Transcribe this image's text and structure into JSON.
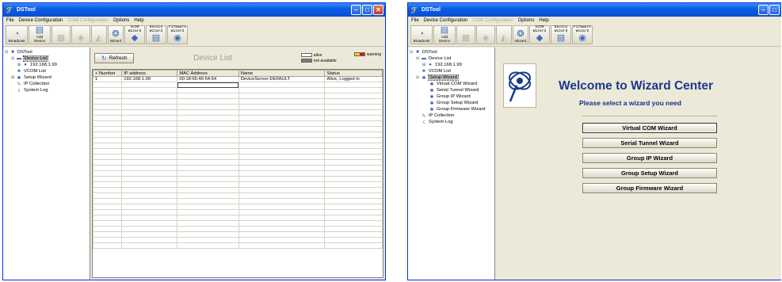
{
  "app": {
    "title": "DSTool"
  },
  "menu": {
    "file": "File",
    "device_config": "Device Configuration",
    "com_config": "COM Configuration",
    "options": "Options",
    "help": "Help"
  },
  "toolbar": {
    "broadcast": "Broadcast",
    "add_device_1": "Add",
    "add_device_2": "Device",
    "wizard": "Wizard",
    "vcom_wizard_1": "VCOM",
    "vcom_wizard_2": "Wizard",
    "device_wizard_1": "Device",
    "device_wizard_2": "Wizard",
    "firmware_wizard_1": "Firmware",
    "firmware_wizard_2": "Wizard"
  },
  "tree": {
    "root": "DSTool",
    "device_list": "Device List",
    "ip_node": "192.168.1.99",
    "vcom_list": "VCOM List",
    "setup_wizard": "Setup Wizard",
    "ip_collection": "IP Collection",
    "system_log": "System Log",
    "wizards": [
      "Virtual COM Wizard",
      "Serial Tunnel Wizard",
      "Group IP Wizard",
      "Group Setup Wizard",
      "Group Firmware Wizard"
    ]
  },
  "device_list": {
    "refresh": "Refresh",
    "title": "Device List",
    "legend": {
      "alive": "alive",
      "not_available": "not available",
      "warning": "warning"
    },
    "columns": [
      "+ Number",
      "IP address",
      "MAC Address",
      "Name",
      "Status"
    ],
    "rows": [
      [
        "1",
        "192.168.1.99",
        "00:18:65:46:54:64",
        "DeviceServer-DEFAULT",
        "Alive, Logged in"
      ]
    ]
  },
  "wizard_center": {
    "title": "Welcome to Wizard Center",
    "subtitle": "Please select a wizard you need",
    "buttons": [
      "Virtual COM Wizard",
      "Serial Tunnel Wizard",
      "Group IP Wizard",
      "Group Setup Wizard",
      "Group Firmware Wizard"
    ]
  },
  "colors": {
    "titlebar": "#0a5ee8",
    "wizard_title": "#1a3a8c",
    "warning_yellow": "#ffd200",
    "warning_red": "#d81818",
    "not_available": "#7a7a7a"
  }
}
